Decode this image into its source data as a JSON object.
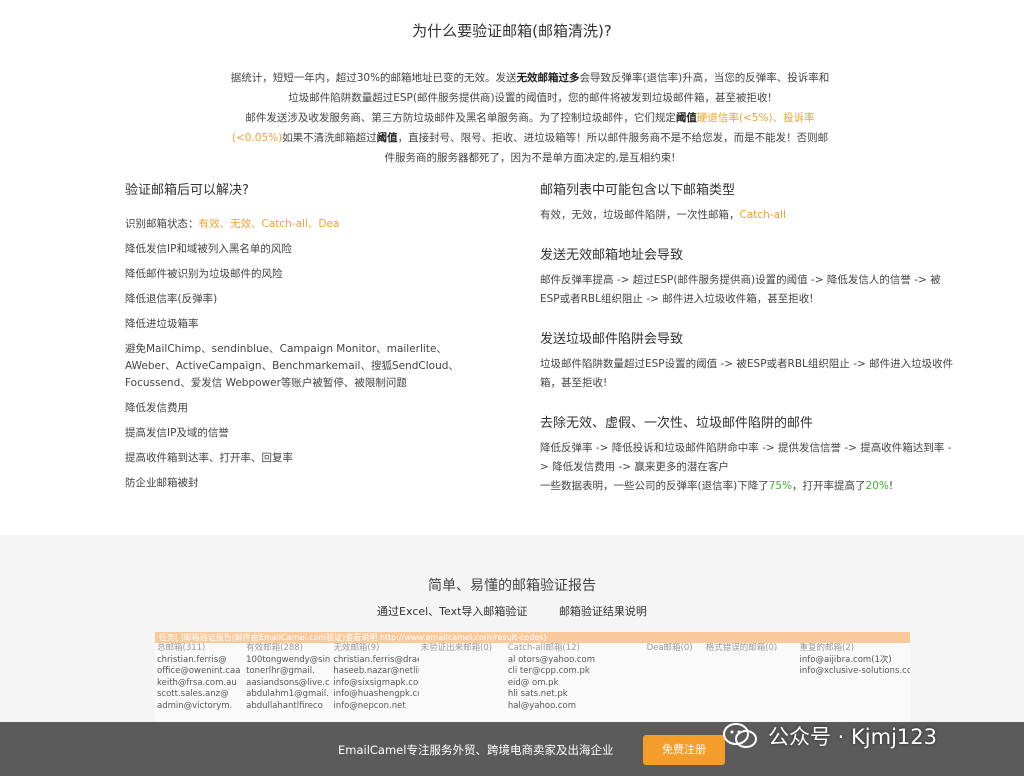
{
  "title": "为什么要验证邮箱(邮箱清洗)?",
  "intro": {
    "l1a": "据统计，短短一年内，超过30%的邮箱地址已变的无效。发送",
    "l1b": "无效邮箱过多",
    "l1c": "会导致反弹率(退信率)升高，当您的反弹率、投诉率和",
    "l2": "垃圾邮件陷阱数量超过ESP(邮件服务提供商)设置的阈值时，您的邮件将被发到垃圾邮件箱，甚至被拒收!",
    "l3a": "邮件发送涉及收发服务商、第三方防垃圾邮件及黑名单服务商。为了控制垃圾邮件，它们规定",
    "l3b": "阈值",
    "l3c": "硬退信率(<5%)、投诉率",
    "l4a": "(<0.05%)",
    "l4b": "如果不清洗邮箱超过",
    "l4c": "阈值",
    "l4d": "，直接封号、限号、拒收、进垃圾箱等！所以邮件服务商不是不给您发，而是不能发！否则邮",
    "l5": "件服务商的服务器都死了，因为不是单方面决定的,是互相约束!"
  },
  "left": {
    "heading": "验证邮箱后可以解决?",
    "status_prefix": "识别邮箱状态：",
    "status_values": "有效、无效、Catch-all、Dea",
    "items": [
      "降低发信IP和域被列入黑名单的风险",
      "降低邮件被识别为垃圾邮件的风险",
      "降低退信率(反弹率)",
      "降低进垃圾箱率",
      "避免MailChimp、sendinblue、Campaign Monitor、mailerlite、AWeber、ActiveCampaign、Benchmarkemail、搜狐SendCloud、Focussend、爱发信 Webpower等账户被暂停、被限制问题",
      "降低发信费用",
      "提高发信IP及域的信誉",
      "提高收件箱到达率、打开率、回复率",
      "防企业邮箱被封"
    ]
  },
  "right": {
    "s1_heading": "邮箱列表中可能包含以下邮箱类型",
    "s1_text": "有效，无效，垃圾邮件陷阱，一次性邮箱，",
    "s1_highlight": "Catch-all",
    "s2_heading": "发送无效邮箱地址会导致",
    "s2_text": "邮件反弹率提高 -> 超过ESP(邮件服务提供商)设置的阈值 -> 降低发信人的信誉 -> 被ESP或者RBL组织阻止 -> 邮件进入垃圾收件箱，甚至拒收!",
    "s3_heading": "发送垃圾邮件陷阱会导致",
    "s3_text": "垃圾邮件陷阱数量超过ESP设置的阈值 -> 被ESP或者RBL组织阻止 -> 邮件进入垃圾收件箱，甚至拒收!",
    "s4_heading": "去除无效、虚假、一次性、垃圾邮件陷阱的邮件",
    "s4_text": "降低反弹率 -> 降低投诉和垃圾邮件陷阱命中率 -> 提供发信信誉 -> 提高收件箱达到率 -> 降低发信费用 -> 赢来更多的潜在客户",
    "s4_stat_a": "一些数据表明，一些公司的反弹率(退信率)下降了",
    "s4_stat_b": "75%",
    "s4_stat_c": "，打开率提高了",
    "s4_stat_d": "20%",
    "s4_stat_e": "!"
  },
  "report": {
    "title": "简单、易懂的邮箱验证报告",
    "link1": "通过Excel、Text导入邮箱验证",
    "link2": "邮箱验证结果说明",
    "banner": "任务[      ]邮箱验证报告(邮件由EmailCamel.com验证)查看说明 http://www.emailcamel.com/result-codes)",
    "headers": [
      "总邮箱(311)",
      "有效邮箱(288)",
      "无效邮箱(9)",
      "未验证出来邮箱(0)",
      "Catch-all邮箱(12)",
      "Dea邮箱(0)",
      "格式错误的邮箱(0)",
      "重复的邮箱(2)"
    ],
    "rows": [
      [
        "christian.ferris@",
        "100tongwendy@sin",
        "christian.ferris@draeger.com",
        "",
        "al       otors@yahoo.com",
        "",
        "",
        "info@aijibra.com(1次)"
      ],
      [
        "office@owenint.caa",
        "tonerlhr@gmail.",
        "haseeb.nazar@netlinks.com.pk",
        "",
        "cli        ter@cpp.com.pk",
        "",
        "",
        "info@xclusive-solutions.cc"
      ],
      [
        "keith@frsa.com.au",
        "aasiandsons@live.c",
        "info@sixsigmapk.com",
        "",
        "eid@        om.pk",
        "",
        "",
        ""
      ],
      [
        "scott.sales.anz@",
        "abdulahm1@gmail.",
        "info@huashengpk.com",
        "",
        "hli        sats.net.pk",
        "",
        "",
        ""
      ],
      [
        "admin@victorym.",
        "abdullahantlfireco",
        "info@nepcon.net",
        "",
        "          hal@yahoo.com",
        "",
        "",
        ""
      ]
    ]
  },
  "footer": {
    "text": "EmailCamel专注服务外贸、跨境电商卖家及出海企业",
    "button": "免费注册"
  },
  "watermark": "公众号 · Kjmj123"
}
